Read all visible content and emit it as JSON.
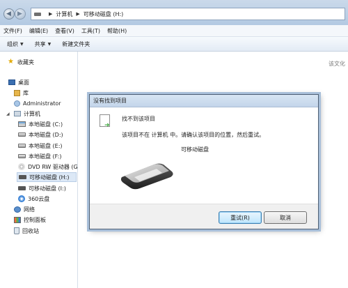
{
  "window": {
    "breadcrumb": [
      "计算机",
      "可移动磁盘 (H:)"
    ]
  },
  "menu": [
    "文件(F)",
    "编辑(E)",
    "查看(V)",
    "工具(T)",
    "帮助(H)"
  ],
  "toolbar": {
    "organize": "组织",
    "share": "共享",
    "new_folder": "新建文件夹"
  },
  "nav": {
    "favorites": "收藏夹",
    "desktop": "桌面",
    "library": "库",
    "user": "Administrator",
    "computer": "计算机",
    "drives": [
      "本地磁盘 (C:)",
      "本地磁盘 (D:)",
      "本地磁盘 (E:)",
      "本地磁盘 (F:)",
      "DVD RW 驱动器 (G",
      "可移动磁盘 (H:)",
      "可移动磁盘 (I:)",
      "360云盘"
    ],
    "network": "网络",
    "control_panel": "控制面板",
    "recycle_bin": "回收站"
  },
  "main": {
    "search_hint": "该文化"
  },
  "dialog": {
    "title": "没有找到项目",
    "heading": "找不到该项目",
    "message": "该项目不在 计算机 中。请确认该项目的位置，然后重试。",
    "device": "可移动磁盘",
    "retry_label": "重试(R)",
    "cancel_label": "取消"
  }
}
